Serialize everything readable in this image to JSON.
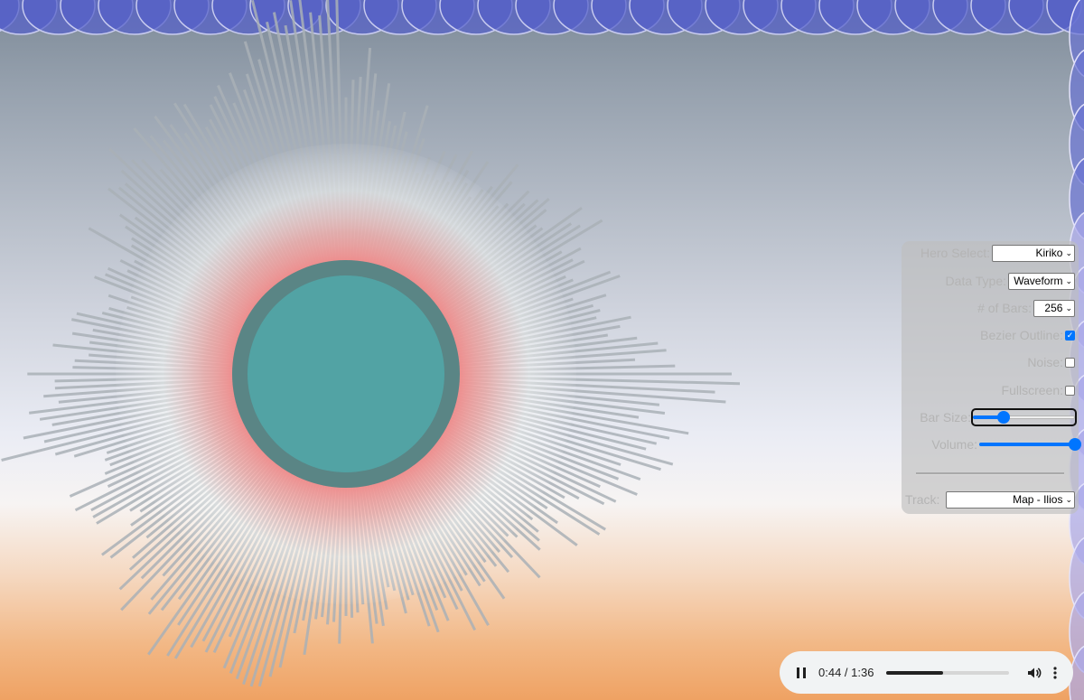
{
  "colors": {
    "orb_fill": "#52a3a4",
    "orb_ring": "#5a8585",
    "glow": "#f57e7e",
    "bar_color": "#a9b0b6",
    "border_shape": "#4a55c4"
  },
  "controls": {
    "hero_select": {
      "label": "Hero Select:",
      "value": "Kiriko"
    },
    "data_type": {
      "label": "Data Type:",
      "value": "Waveform"
    },
    "num_bars": {
      "label": "# of Bars:",
      "value": "256"
    },
    "bezier_outline": {
      "label": "Bezier Outline:",
      "checked": true
    },
    "noise": {
      "label": "Noise:",
      "checked": false
    },
    "fullscreen": {
      "label": "Fullscreen:",
      "checked": false
    },
    "bar_size": {
      "label": "Bar Size:",
      "level": 0.3
    },
    "volume": {
      "label": "Volume:",
      "level": 1.0
    },
    "track": {
      "label": "Track:",
      "value": "Map - Ilios"
    }
  },
  "player": {
    "time": "0:44 / 1:36",
    "progress": 0.458,
    "play_icon": "pause-icon",
    "volume_icon": "volume-icon",
    "menu_icon": "more-vert-icon"
  }
}
